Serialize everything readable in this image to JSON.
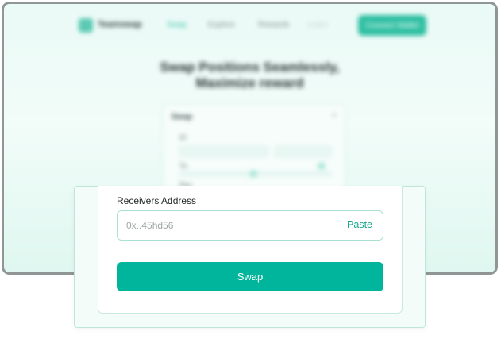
{
  "background": {
    "logo_text": "Teamswap",
    "nav": [
      "Swap",
      "Explore",
      "Rewards",
      "Learn"
    ],
    "nav_cta": "Connect Wallet",
    "headline_line1": "Swap Positions Seamlessly,",
    "headline_line2": "Maximize reward",
    "card_title": "Swap",
    "card_close": "×",
    "card_labels": [
      "ID",
      "To",
      "Rec"
    ]
  },
  "form": {
    "receivers_label": "Receivers Address",
    "address_placeholder": "0x..45hd56",
    "address_value": "",
    "paste_label": "Paste",
    "swap_label": "Swap"
  },
  "colors": {
    "accent": "#00b59b",
    "paste_text": "#1aa78c",
    "field_border": "#a9e0d3",
    "popup_bg": "#f3fcf9"
  }
}
